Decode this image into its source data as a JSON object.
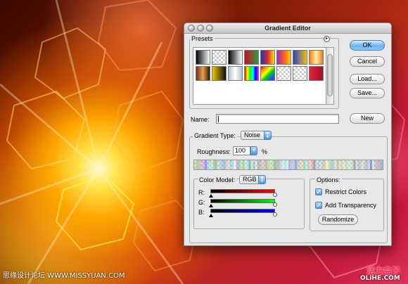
{
  "window": {
    "title": "Gradient Editor"
  },
  "presets": {
    "label": "Presets",
    "menu_icon": "circle-arrow-menu-icon",
    "swatches": [
      "linear-gradient(90deg,#000,#fff)",
      "repeating-conic-gradient(#ccc 0 25%, #fff 0 50%) 0 0/6px 6px",
      "linear-gradient(90deg,#000,#fff)",
      "linear-gradient(90deg,#c8102e,#2a9a3a)",
      "linear-gradient(90deg,#2030c0,#e02a2a,#f6e01a)",
      "linear-gradient(90deg,#9a2bc0,#ff5a20,#ffd000)",
      "linear-gradient(90deg,#3040d0,#f0c010)",
      "linear-gradient(90deg,#f07818,#fff0a0,#f07818)",
      "linear-gradient(90deg,#6b2f14,#e6a14a,#2a1408)",
      "linear-gradient(90deg,#f0c000,#111)",
      "linear-gradient(90deg,#b0c0d0,#fff,#b0c0d0)",
      "linear-gradient(90deg,#ff0000,#ffff00,#00ff00,#00ffff,#0000ff,#ff00ff)",
      "linear-gradient(135deg,#ff0000,#ff9900,#ffff00,#00cc00,#0066ff,#9900cc)",
      "repeating-conic-gradient(#ccc 0 25%, #fff 0 50%) 0 0/6px 6px",
      "repeating-conic-gradient(#ccc 0 25%, #fff 0 50%) 0 0/6px 6px",
      "linear-gradient(90deg,#e8203a,#a0102a)"
    ]
  },
  "buttons": {
    "ok": "OK",
    "cancel": "Cancel",
    "load": "Load...",
    "save": "Save...",
    "new": "New",
    "randomize": "Randomize"
  },
  "name": {
    "label": "Name:",
    "value": ""
  },
  "gradient_type": {
    "label": "Gradient Type:",
    "value": "Noise"
  },
  "roughness": {
    "label": "Roughness:",
    "value": "100",
    "unit": "%"
  },
  "color_model": {
    "label": "Color Model:",
    "value": "RGB",
    "channels": [
      {
        "name": "R:",
        "gradient": "linear-gradient(90deg,#000,#ff0000)"
      },
      {
        "name": "G:",
        "gradient": "linear-gradient(90deg,#000,#00ff00)"
      },
      {
        "name": "B:",
        "gradient": "linear-gradient(90deg,#000,#0000ff)"
      }
    ]
  },
  "options": {
    "label": "Options:",
    "restrict_colors": {
      "label": "Restrict Colors",
      "checked": true
    },
    "add_transparency": {
      "label": "Add Transparency",
      "checked": true
    }
  },
  "watermarks": {
    "left": "思缘设计论坛 WWW.MISSYUAN.COM",
    "right_top": "活力盒子",
    "right_bottom": "OLiHE.COM"
  }
}
